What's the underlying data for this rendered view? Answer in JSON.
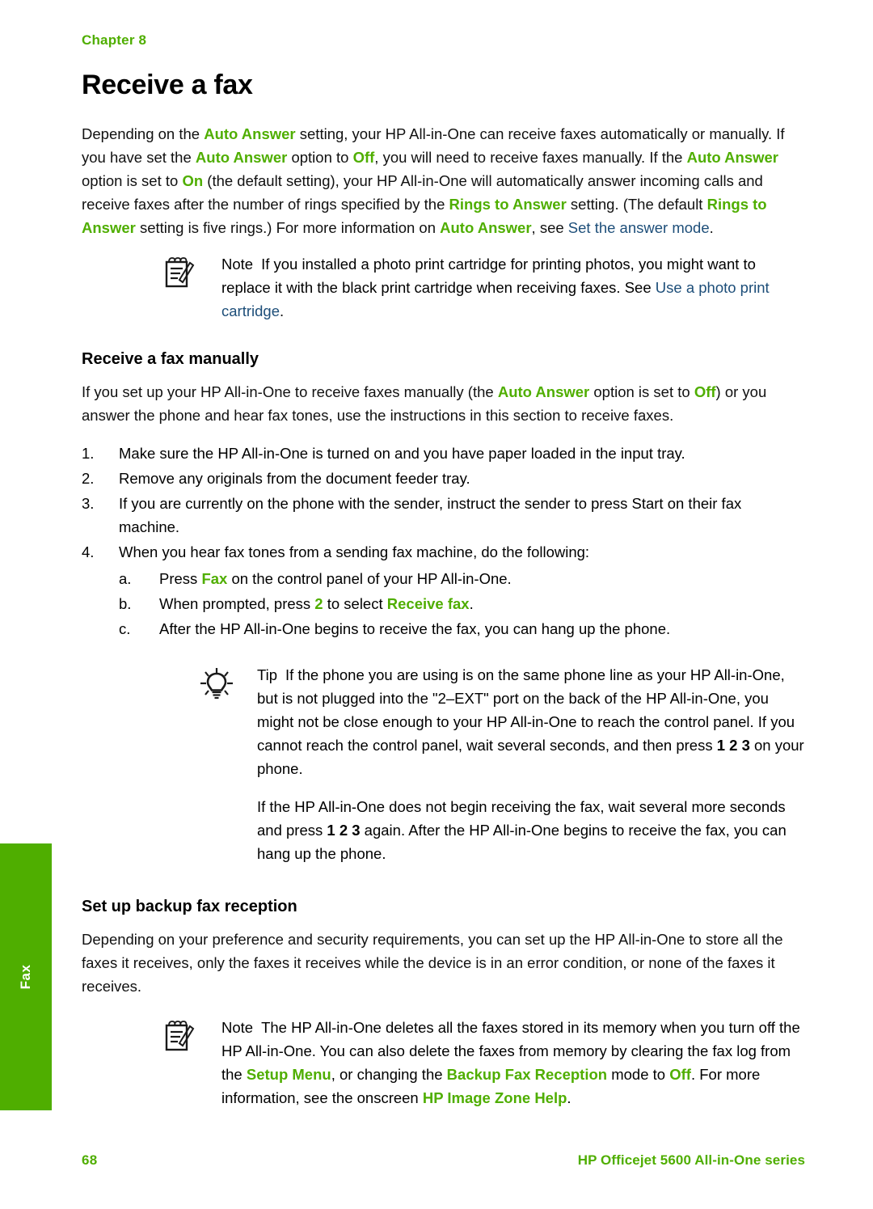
{
  "colors": {
    "brand_green": "#4fae00",
    "link_blue": "#1d4e79",
    "body_black": "#111111"
  },
  "side_tab": {
    "label": "Fax"
  },
  "header": {
    "chapter": "Chapter 8"
  },
  "page_title": "Receive a fax",
  "intro": {
    "s1": "Depending on the ",
    "k1": "Auto Answer",
    "s2": " setting, your HP All-in-One can receive faxes automatically or manually. If you have set the ",
    "k2": "Auto Answer",
    "s3": " option to ",
    "k3": "Off",
    "s4": ", you will need to receive faxes manually. If the ",
    "k4": "Auto Answer",
    "s5": " option is set to ",
    "k5": "On",
    "s6": " (the default setting), your HP All-in-One will automatically answer incoming calls and receive faxes after the number of rings specified by the ",
    "k6": "Rings to Answer",
    "s7": " setting. (The default ",
    "k7": "Rings to Answer",
    "s8": " setting is five rings.) For more information on ",
    "k8": "Auto Answer",
    "s9": ", see ",
    "link1": "Set the answer mode",
    "s10": "."
  },
  "note1": {
    "icon": "notepad-pencil-icon",
    "keyword": "Note",
    "s1": "If you installed a photo print cartridge for printing photos, you might want to replace it with the black print cartridge when receiving faxes. See ",
    "link1": "Use a photo print cartridge",
    "s2": "."
  },
  "section_manual": {
    "heading": "Receive a fax manually",
    "para": {
      "s1": "If you set up your HP All-in-One to receive faxes manually (the ",
      "k1": "Auto Answer",
      "s2": " option is set to ",
      "k2": "Off",
      "s3": ") or you answer the phone and hear fax tones, use the instructions in this section to receive faxes."
    },
    "steps": [
      "Make sure the HP All-in-One is turned on and you have paper loaded in the input tray.",
      "Remove any originals from the document feeder tray.",
      "If you are currently on the phone with the sender, instruct the sender to press Start on their fax machine.",
      "When you hear fax tones from a sending fax machine, do the following:"
    ],
    "substeps": {
      "a": {
        "s1": "Press ",
        "k1": "Fax",
        "s2": " on the control panel of your HP All-in-One."
      },
      "b": {
        "s1": "When prompted, press ",
        "k1": "2",
        "s2": " to select ",
        "k2": "Receive fax",
        "s3": "."
      },
      "c": {
        "s1": "After the HP All-in-One begins to receive the fax, you can hang up the phone."
      }
    }
  },
  "tip1": {
    "icon": "lightbulb-icon",
    "keyword": "Tip",
    "p1_s1": "If the phone you are using is on the same phone line as your HP All-in-One, but is not plugged into the \"2–EXT\" port on the back of the HP All-in-One, you might not be close enough to your HP All-in-One to reach the control panel. If you cannot reach the control panel, wait several seconds, and then press ",
    "p1_k1": "1 2 3",
    "p1_s2": " on your phone.",
    "p2_s1": "If the HP All-in-One does not begin receiving the fax, wait several more seconds and press ",
    "p2_k1": "1 2 3",
    "p2_s2": " again. After the HP All-in-One begins to receive the fax, you can hang up the phone."
  },
  "section_backup": {
    "heading": "Set up backup fax reception",
    "para": "Depending on your preference and security requirements, you can set up the HP All-in-One to store all the faxes it receives, only the faxes it receives while the device is in an error condition, or none of the faxes it receives."
  },
  "note2": {
    "icon": "notepad-pencil-icon",
    "keyword": "Note",
    "s1": "The HP All-in-One deletes all the faxes stored in its memory when you turn off the HP All-in-One. You can also delete the faxes from memory by clearing the fax log from the ",
    "k1": "Setup Menu",
    "s2": ", or changing the ",
    "k2": "Backup Fax Reception",
    "s3": " mode to ",
    "k3": "Off",
    "s4": ". For more information, see the onscreen ",
    "k4": "HP Image Zone Help",
    "s5": "."
  },
  "footer": {
    "page_number": "68",
    "product": "HP Officejet 5600 All-in-One series"
  }
}
